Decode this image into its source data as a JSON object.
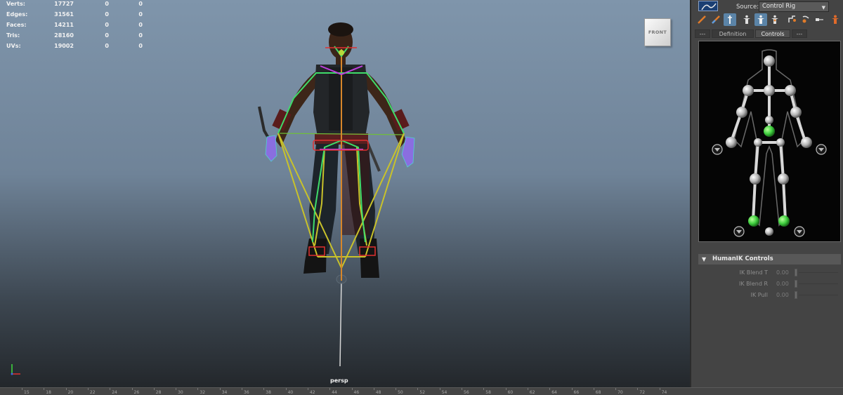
{
  "hud": {
    "rows": [
      {
        "label": "Verts:",
        "v1": "17727",
        "v2": "0",
        "v3": "0"
      },
      {
        "label": "Edges:",
        "v1": "31561",
        "v2": "0",
        "v3": "0"
      },
      {
        "label": "Faces:",
        "v1": "14211",
        "v2": "0",
        "v3": "0"
      },
      {
        "label": "Tris:",
        "v1": "28160",
        "v2": "0",
        "v3": "0"
      },
      {
        "label": "UVs:",
        "v1": "19002",
        "v2": "0",
        "v3": "0"
      }
    ]
  },
  "viewport": {
    "viewcube_label": "FRONT",
    "camera_label": "persp"
  },
  "panel": {
    "source_label": "Source:",
    "source_value": "Control Rig",
    "tabs": [
      {
        "label": "---"
      },
      {
        "label": "Definition"
      },
      {
        "label": "Controls"
      },
      {
        "label": "---"
      }
    ],
    "section_title": "HumanIK Controls",
    "sliders": [
      {
        "label": "IK Blend T",
        "value": "0.00"
      },
      {
        "label": "IK Blend R",
        "value": "0.00"
      },
      {
        "label": "IK Pull",
        "value": "0.00"
      }
    ]
  },
  "toolbar_icons": [
    "pencil-icon",
    "pencil-icon",
    "skeleton-icon",
    "figure-icon",
    "figure-icon",
    "figure-icon",
    "key-icon",
    "key-icon",
    "arrow-icon",
    "person-icon"
  ],
  "timeline": {
    "labels": [
      "15",
      "18",
      "20",
      "22",
      "24",
      "26",
      "28",
      "30",
      "32",
      "34",
      "36",
      "38",
      "40",
      "42",
      "44",
      "46",
      "48",
      "50",
      "52",
      "54",
      "56",
      "58",
      "60",
      "62",
      "64",
      "66",
      "68",
      "70",
      "72",
      "74"
    ]
  },
  "colors": {
    "selected_effector": "#3fcf3f",
    "joint_gray": "#bdbdbd",
    "rig_yellow": "#c9c22a",
    "accent_blue": "#5b84a8"
  }
}
